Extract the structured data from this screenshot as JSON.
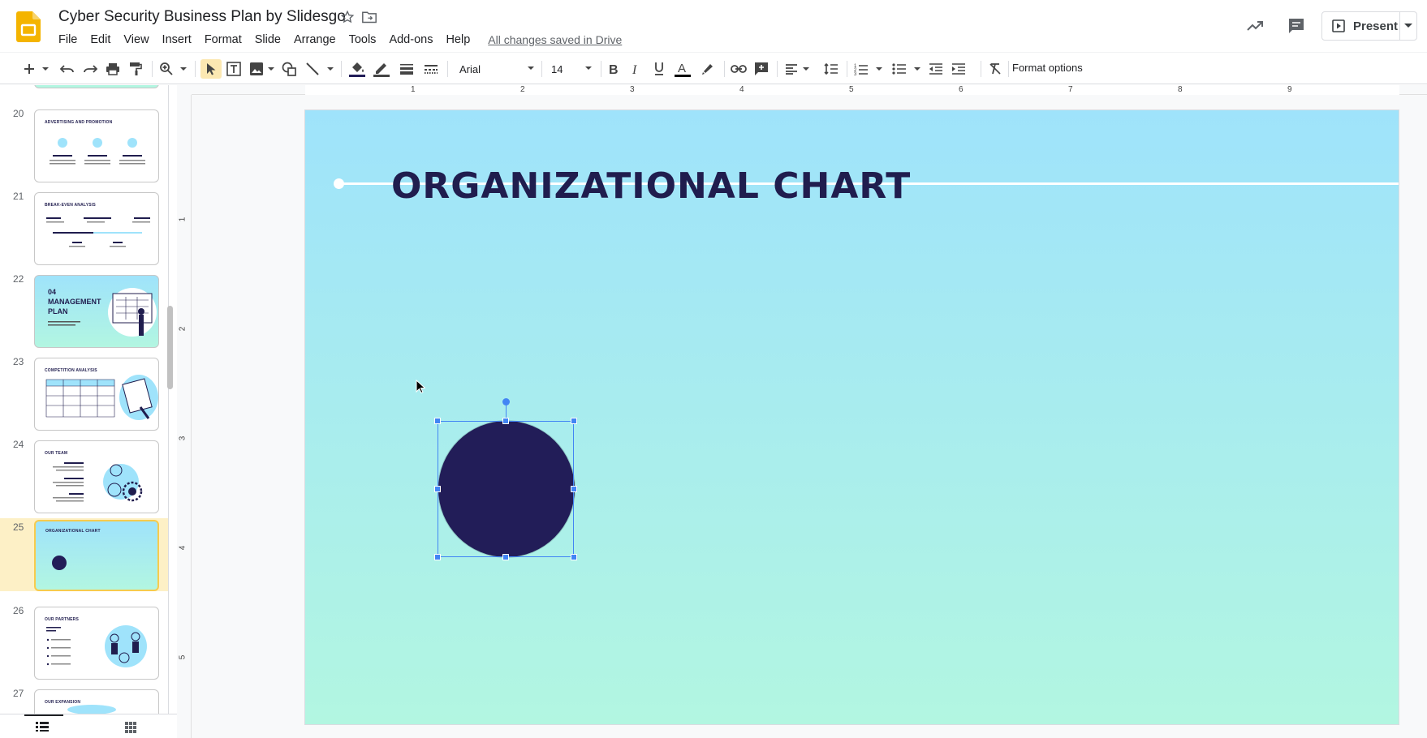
{
  "header": {
    "doc_title": "Cyber Security Business Plan by Slidesgo",
    "saved_status": "All changes saved in Drive",
    "present_label": "Present"
  },
  "menu": [
    "File",
    "Edit",
    "View",
    "Insert",
    "Format",
    "Slide",
    "Arrange",
    "Tools",
    "Add-ons",
    "Help"
  ],
  "toolbar": {
    "font_family": "Arial",
    "font_size": "14",
    "format_options": "Format options"
  },
  "filmstrip": {
    "slides": [
      {
        "num": "20",
        "title": "ADVERTISING AND PROMOTION"
      },
      {
        "num": "21",
        "title": "BREAK-EVEN ANALYSIS"
      },
      {
        "num": "22",
        "title": "04 MANAGEMENT PLAN"
      },
      {
        "num": "23",
        "title": "COMPETITION ANALYSIS"
      },
      {
        "num": "24",
        "title": "OUR TEAM"
      },
      {
        "num": "25",
        "title": "ORGANIZATIONAL CHART"
      },
      {
        "num": "26",
        "title": "OUR PARTNERS"
      },
      {
        "num": "27",
        "title": "OUR EXPANSION"
      }
    ],
    "selected": "25"
  },
  "ruler": {
    "top": [
      "1",
      "2",
      "3",
      "4",
      "5",
      "6",
      "7",
      "8",
      "9"
    ],
    "left": [
      "1",
      "2",
      "3",
      "4",
      "5"
    ]
  },
  "slide": {
    "title": "ORGANIZATIONAL CHART"
  },
  "colors": {
    "accent_blue": "#4285f4",
    "slide_title": "#201d4e",
    "circle": "#221d58",
    "bg_top": "#9fe3fb",
    "bg_bottom": "#b2f6e1"
  }
}
